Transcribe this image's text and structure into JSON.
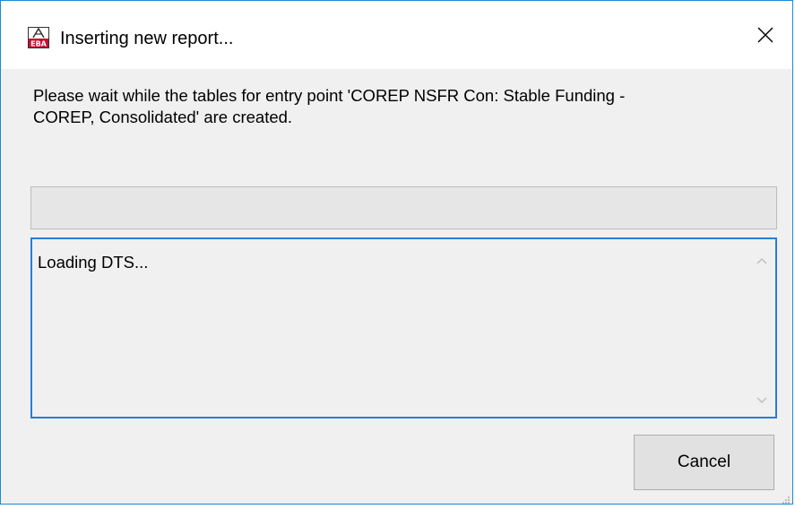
{
  "window": {
    "title": "Inserting new report...",
    "app_icon": "eba-app-icon",
    "close_icon": "close-icon"
  },
  "message": "Please wait while the tables for entry point 'COREP NSFR Con: Stable Funding -\nCOREP, Consolidated' are created.",
  "progress": {
    "value": 0
  },
  "log": {
    "text": "Loading DTS..."
  },
  "buttons": {
    "cancel_label": "Cancel"
  },
  "colors": {
    "border_accent": "#1a8ad4",
    "log_border": "#2a7bd5",
    "dialog_bg": "#f0f0f0"
  }
}
